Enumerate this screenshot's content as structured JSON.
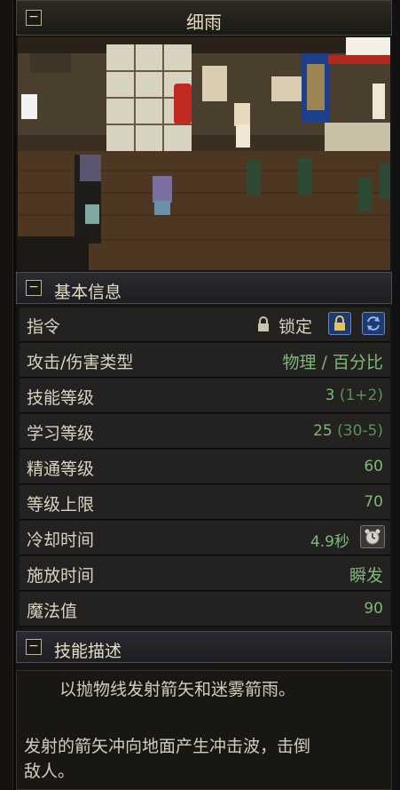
{
  "window": {
    "title": "细雨"
  },
  "basic_info": {
    "header": "基本信息",
    "command": {
      "label": "指令",
      "status_text": "锁定"
    },
    "rows": [
      {
        "label": "攻击/伤害类型",
        "value": "物理 / 百分比"
      },
      {
        "label": "技能等级",
        "value": "3",
        "detail": "(1+2)"
      },
      {
        "label": "学习等级",
        "value": "25",
        "detail": "(30-5)"
      },
      {
        "label": "精通等级",
        "value": "60"
      },
      {
        "label": "等级上限",
        "value": "70"
      },
      {
        "label": "冷却时间",
        "value": "4.9秒"
      },
      {
        "label": "施放时间",
        "value": "瞬发"
      },
      {
        "label": "魔法值",
        "value": "90"
      }
    ]
  },
  "skill_description": {
    "header": "技能描述",
    "line1": "以抛物线发射箭矢和迷雾箭雨。",
    "line2": "发射的箭矢冲向地面产生冲击波，击倒",
    "line3": "敌人。"
  },
  "icons": {
    "collapse": "minus-box-icon",
    "lock_indicator": "padlock-icon",
    "lock_button": "padlock-icon",
    "sync_button": "cycle-arrows-icon",
    "clock_button": "alarm-clock-icon"
  },
  "colors": {
    "value_green": "#7fb87a",
    "title_text": "#e8dcc0",
    "lock_button_blue": "#1f3b6e"
  }
}
